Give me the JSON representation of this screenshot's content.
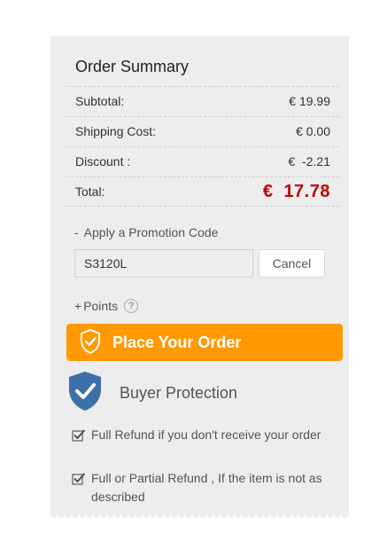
{
  "order_summary": {
    "title": "Order Summary",
    "subtotal_label": "Subtotal:",
    "subtotal_value": "€ 19.99",
    "shipping_label": "Shipping Cost:",
    "shipping_value": "€ 0.00",
    "discount_label": "Discount :",
    "discount_value": "€  -2.21",
    "total_label": "Total:",
    "total_currency": "€",
    "total_amount": "17.78"
  },
  "promotion": {
    "toggle_symbol": "-",
    "toggle_label": "Apply a Promotion Code",
    "code_value": "S3120L",
    "cancel_label": "Cancel"
  },
  "points": {
    "symbol": "+",
    "label": "Points",
    "help_glyph": "?"
  },
  "place_order": {
    "label": "Place Your Order",
    "icon": "shield-check-icon"
  },
  "buyer_protection": {
    "label": "Buyer Protection",
    "icon": "shield-check-icon",
    "items": [
      {
        "text": "Full Refund if you don't receive your order",
        "icon": "checkbox-icon"
      },
      {
        "text": "Full or Partial Refund , If the item is not as described",
        "icon": "checkbox-icon"
      }
    ]
  },
  "colors": {
    "panel_bg": "#ededed",
    "accent_orange": "#ff9900",
    "total_red": "#c00000",
    "shield_blue": "#3d6fa8"
  }
}
